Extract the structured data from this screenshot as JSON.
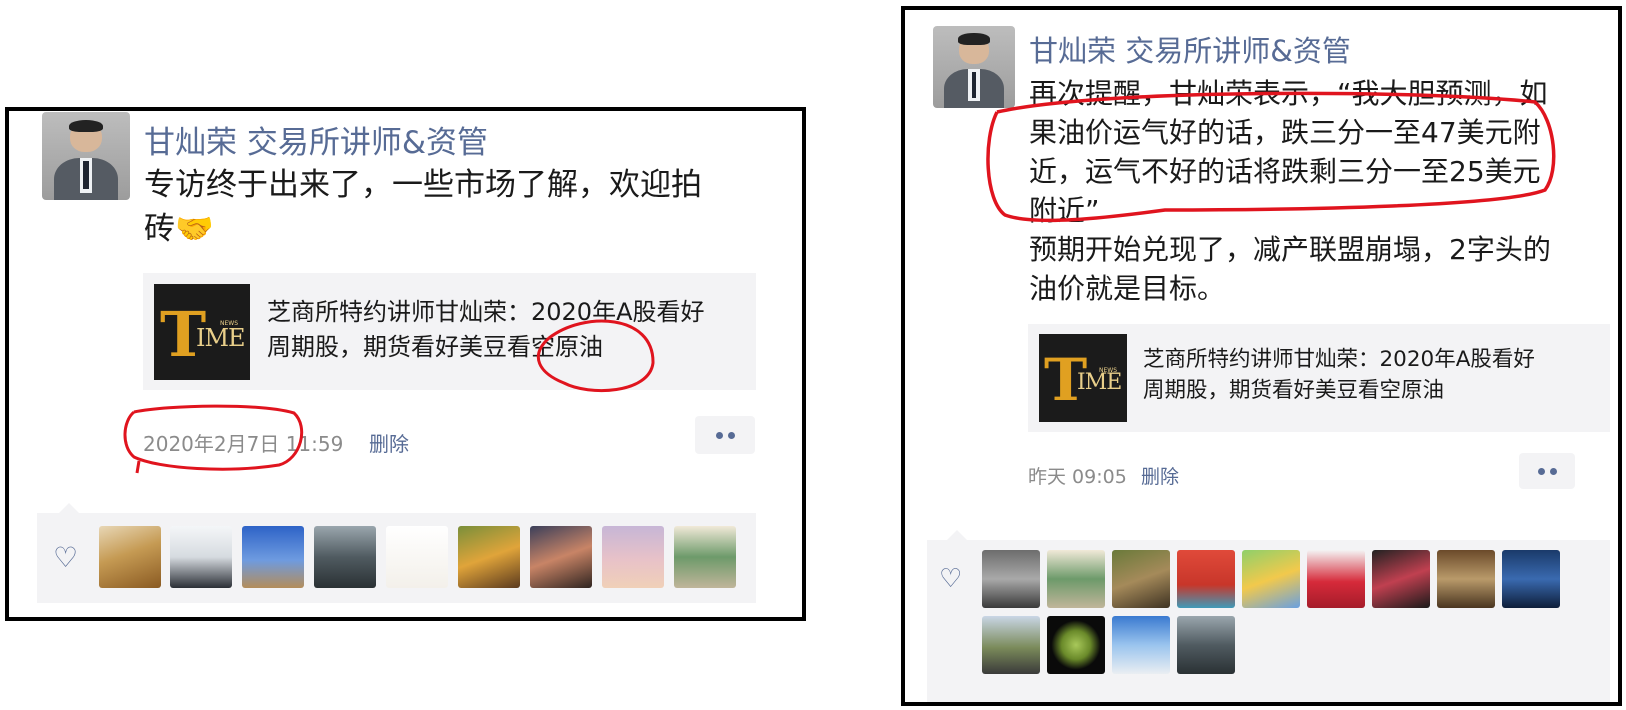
{
  "left_post": {
    "author": "甘灿荣  交易所讲师&资管",
    "text_line1": "专访终于出来了，一些市场了解，欢迎拍",
    "text_line2": "砖🤝",
    "card": {
      "thumb_logo": "TIME",
      "thumb_badge": "NEWS",
      "title_line1": "芝商所特约讲师甘灿荣：2020年A股看好",
      "title_line2": "周期股，期货看好美豆看空原油"
    },
    "time": "2020年2月7日 11:59",
    "delete_label": "删除",
    "likes_icon": "heart-outline-icon"
  },
  "right_post": {
    "author": "甘灿荣  交易所讲师&资管",
    "text_lines": [
      "再次提醒，甘灿荣表示，“我大胆预测，如",
      "果油价运气好的话，跌三分一至47美元附",
      "近，运气不好的话将跌剩三分一至25美元",
      "附近”",
      "预期开始兑现了，减产联盟崩塌，2字头的",
      "油价就是目标。"
    ],
    "card": {
      "thumb_logo": "TIME",
      "thumb_badge": "NEWS",
      "title_line1": "芝商所特约讲师甘灿荣：2020年A股看好",
      "title_line2": "周期股，期货看好美豆看空原油"
    },
    "time": "昨天 09:05",
    "delete_label": "删除",
    "likes_icon": "heart-outline-icon"
  },
  "colors": {
    "link_blue": "#576b95",
    "annotation_red": "#e0141e",
    "card_bg": "#f3f3f5",
    "logo_gold": "#e0a021"
  }
}
